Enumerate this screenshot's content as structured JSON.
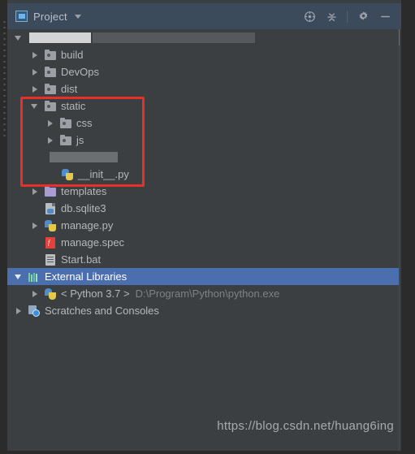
{
  "window": {
    "title": "Project",
    "project_icon": "project-icon",
    "toolbar_buttons": [
      {
        "name": "locate-icon",
        "tooltip": "Select Opened File"
      },
      {
        "name": "collapse-all-icon",
        "tooltip": "Collapse All"
      },
      {
        "name": "settings-gear-icon",
        "tooltip": "Settings"
      },
      {
        "name": "minimize-icon",
        "tooltip": "Hide"
      }
    ]
  },
  "tree": {
    "nodes": [
      {
        "id": "root",
        "label": "",
        "indent": 0,
        "arrow": "down",
        "icon": "none",
        "redacted": true,
        "redact_light_w": 76,
        "redact_dark_w": 200
      },
      {
        "id": "build",
        "label": "build",
        "indent": 1,
        "arrow": "right",
        "icon": "folder-icon"
      },
      {
        "id": "devops",
        "label": "DevOps",
        "indent": 1,
        "arrow": "right",
        "icon": "folder-icon"
      },
      {
        "id": "dist",
        "label": "dist",
        "indent": 1,
        "arrow": "right",
        "icon": "folder-icon"
      },
      {
        "id": "static",
        "label": "static",
        "indent": 1,
        "arrow": "down",
        "icon": "folder-icon"
      },
      {
        "id": "css",
        "label": "css",
        "indent": 2,
        "arrow": "right",
        "icon": "folder-icon"
      },
      {
        "id": "js",
        "label": "js",
        "indent": 2,
        "arrow": "right",
        "icon": "folder-icon"
      },
      {
        "id": "redacted-pkg",
        "label": "",
        "indent": 2,
        "arrow": "none",
        "icon": "none",
        "redacted": true,
        "redact_dark_w": 84
      },
      {
        "id": "init-py",
        "label": "__init__.py",
        "indent": 3,
        "arrow": "none",
        "icon": "python-file-icon"
      },
      {
        "id": "templates",
        "label": "templates",
        "indent": 1,
        "arrow": "right",
        "icon": "folder-purple-icon"
      },
      {
        "id": "db-sqlite3",
        "label": "db.sqlite3",
        "indent": 1,
        "arrow": "none",
        "icon": "database-file-icon"
      },
      {
        "id": "manage-py",
        "label": "manage.py",
        "indent": 1,
        "arrow": "right",
        "icon": "python-file-icon"
      },
      {
        "id": "manage-spec",
        "label": "manage.spec",
        "indent": 1,
        "arrow": "none",
        "icon": "spec-file-icon"
      },
      {
        "id": "start-bat",
        "label": "Start.bat",
        "indent": 1,
        "arrow": "none",
        "icon": "bat-file-icon"
      },
      {
        "id": "ext-libs",
        "label": "External Libraries",
        "indent": 0,
        "arrow": "down",
        "icon": "library-icon",
        "selected": true
      },
      {
        "id": "python-sdk",
        "label": "< Python 3.7 >",
        "indent": 1,
        "arrow": "right",
        "icon": "python-logo-icon",
        "note": "D:\\Program\\Python\\python.exe"
      },
      {
        "id": "scratches",
        "label": "Scratches and Consoles",
        "indent": 0,
        "arrow": "right",
        "icon": "scratches-icon"
      }
    ]
  },
  "annotation": {
    "type": "rectangle-highlight",
    "color": "#e8302a",
    "covers": [
      "static",
      "css",
      "js",
      "redacted-pkg",
      "init-py"
    ]
  },
  "watermark": {
    "text": "https://blog.csdn.net/huang6ing"
  },
  "colors": {
    "panel_bg": "#3c3f41",
    "titlebar_bg": "#3c4b5c",
    "frame_bg": "#2b2b2b",
    "selection_blue": "#4b6eaf",
    "text": "#b5b8ba",
    "muted_text": "#7d8285",
    "annotation_red": "#e8302a"
  }
}
